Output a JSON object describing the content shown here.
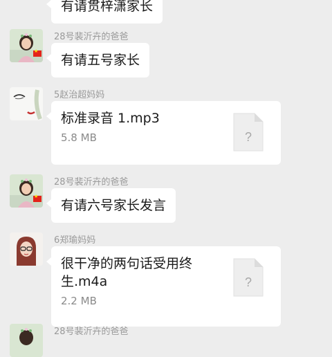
{
  "messages": [
    {
      "sender": "",
      "text": "有请贯梓潇家长"
    },
    {
      "sender": "28号裴沂卉的爸爸",
      "text": "有请五号家长"
    },
    {
      "sender": "5赵治超妈妈",
      "file": {
        "name": "标准录音 1.mp3",
        "size": "5.8 MB",
        "icon": "unknown-file-icon",
        "glyph": "?"
      }
    },
    {
      "sender": "28号裴沂卉的爸爸",
      "text": "有请六号家长发言"
    },
    {
      "sender": "6郑瑜妈妈",
      "file": {
        "name": "很干净的两句话受用终生.m4a",
        "size": "2.2 MB",
        "icon": "unknown-file-icon",
        "glyph": "?"
      }
    },
    {
      "sender": "28号裴沂卉的爸爸"
    }
  ],
  "colors": {
    "background": "#ededed",
    "bubble": "#ffffff",
    "sender_name": "#9a9a9a",
    "flag": "#e4231b"
  }
}
